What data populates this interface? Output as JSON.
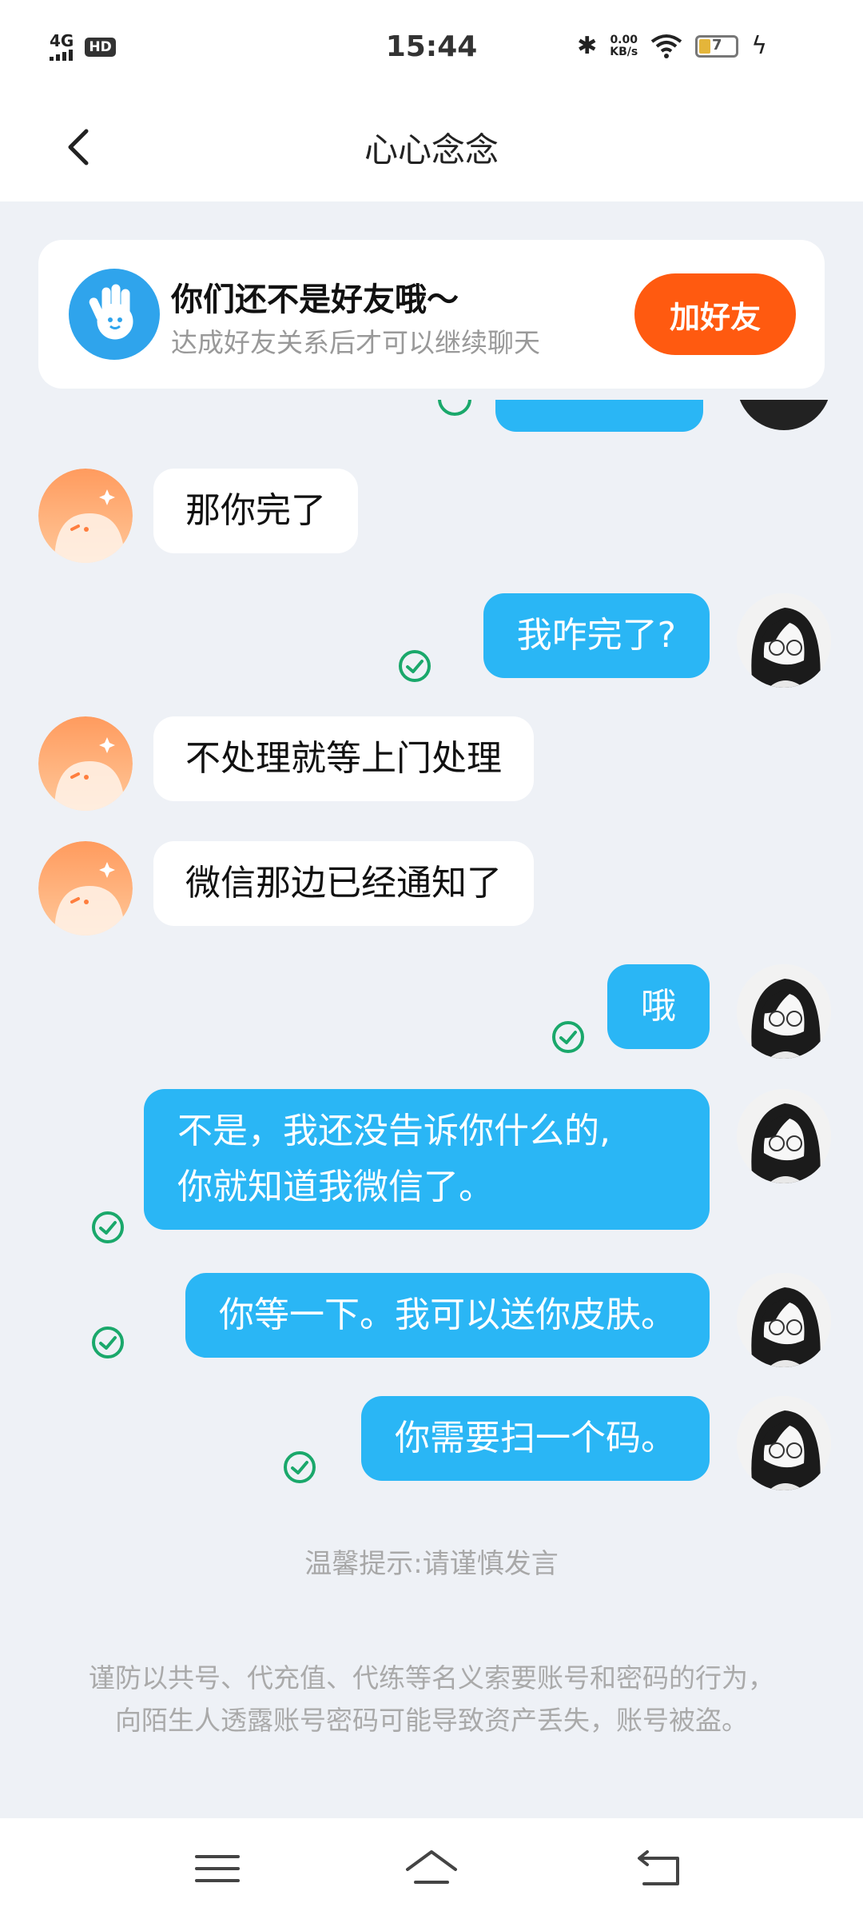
{
  "status_bar": {
    "network": "4G",
    "hd_badge": "HD",
    "time": "15:44",
    "speed_value": "0.00",
    "speed_unit": "KB/s",
    "battery": "7"
  },
  "header": {
    "title": "心心念念"
  },
  "friend_banner": {
    "title": "你们还不是好友哦～",
    "subtitle": "达成好友关系后才可以继续聊天",
    "add_button": "加好友"
  },
  "messages": [
    {
      "from": "other",
      "text": "那你完了"
    },
    {
      "from": "me",
      "text": "我咋完了?"
    },
    {
      "from": "other",
      "text": "不处理就等上门处理"
    },
    {
      "from": "other",
      "text": "微信那边已经通知了"
    },
    {
      "from": "me",
      "text": "哦"
    },
    {
      "from": "me",
      "text_line1": "不是，我还没告诉你什么的,",
      "text_line2": "你就知道我微信了。"
    },
    {
      "from": "me",
      "text": "你等一下。我可以送你皮肤。"
    },
    {
      "from": "me",
      "text": "你需要扫一个码。"
    }
  ],
  "tip": "温馨提示:请谨慎发言",
  "warning": "谨防以共号、代充值、代练等名义索要账号和密码的行为，向陌生人透露账号密码可能导致资产丢失，账号被盗。",
  "colors": {
    "accent_blue": "#2ab6f5",
    "add_button_orange": "#ff5a10",
    "check_green": "#1aa86b",
    "background": "#eef1f6"
  },
  "icons": {
    "back": "chevron-left-icon",
    "banner": "waving-hand-icon",
    "delivered": "check-circle-icon",
    "nav_menu": "menu-icon",
    "nav_home": "home-icon",
    "nav_back": "return-icon"
  }
}
